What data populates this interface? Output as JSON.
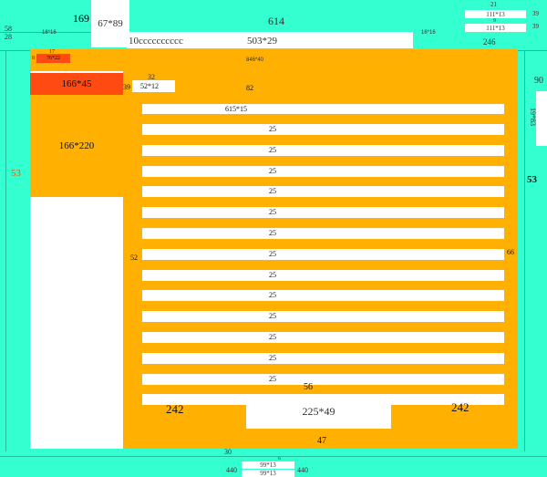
{
  "colors": {
    "teal": "#33FFD1",
    "orange": "#FFB000",
    "red": "#FF4A12",
    "white": "#FFFFFF"
  },
  "top": {
    "label_169": "169",
    "box_67x89": "67*89",
    "label_614": "614",
    "label_58": "58",
    "label_28": "28",
    "tiny_left": "16*16",
    "input_text": "10cccccccccc",
    "input_size": "503*29",
    "tiny_mid": "16*16",
    "label_246": "246",
    "label_21": "21",
    "box_a": "111*13",
    "label_39a": "39",
    "label_9": "9",
    "box_b": "111*13",
    "label_39b": "39"
  },
  "right_panel": {
    "label_90": "90",
    "card": "19*83",
    "label_53": "53"
  },
  "left_panel": {
    "label_53": "53"
  },
  "bar": {
    "label_8": "8",
    "label_17": "17",
    "tag": "76*22",
    "center": "846*40"
  },
  "sidebar": {
    "header": "166*45",
    "body": "166*220"
  },
  "main": {
    "label_32": "32",
    "label_39": "39",
    "chip": "52*12",
    "label_82": "82",
    "header_row": "615*15",
    "row_heights": [
      "25",
      "25",
      "25",
      "25",
      "25",
      "25",
      "25",
      "25",
      "25",
      "25",
      "25",
      "25",
      "25",
      "25"
    ],
    "label_52": "52",
    "label_66": "66",
    "label_56": "56",
    "footer_left": "242",
    "footer_box": "225*49",
    "footer_right": "242",
    "label_47": "47"
  },
  "bottom": {
    "label_30": "30",
    "label_6": "6",
    "label_440_left": "440",
    "box_a": "99*13",
    "box_b": "99*13",
    "label_440_right": "440"
  }
}
